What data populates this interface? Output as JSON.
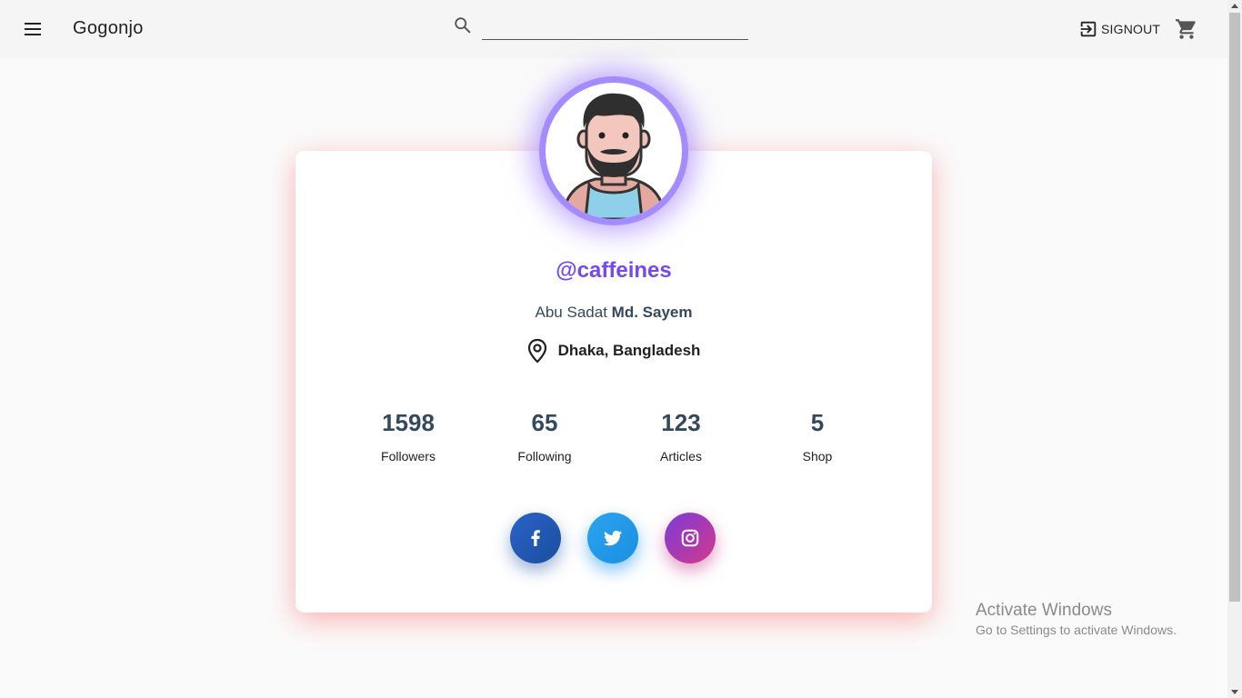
{
  "header": {
    "brand": "Gogonjo",
    "search": {
      "value": "",
      "placeholder": ""
    },
    "signout_label": "SIGNOUT"
  },
  "profile": {
    "username": "@caffeines",
    "first_name": "Abu Sadat",
    "last_name": "Md. Sayem",
    "location": "Dhaka, Bangladesh",
    "stats": [
      {
        "value": "1598",
        "label": "Followers"
      },
      {
        "value": "65",
        "label": "Following"
      },
      {
        "value": "123",
        "label": "Articles"
      },
      {
        "value": "5",
        "label": "Shop"
      }
    ],
    "social": [
      {
        "name": "facebook-icon"
      },
      {
        "name": "twitter-icon"
      },
      {
        "name": "instagram-icon"
      }
    ]
  },
  "colors": {
    "accent": "#7448f2",
    "avatar_ring": "#a48bff",
    "card_glow": "#ff5a5a",
    "stat_text": "#34495e"
  },
  "watermark": {
    "title": "Activate Windows",
    "subtitle": "Go to Settings to activate Windows."
  }
}
